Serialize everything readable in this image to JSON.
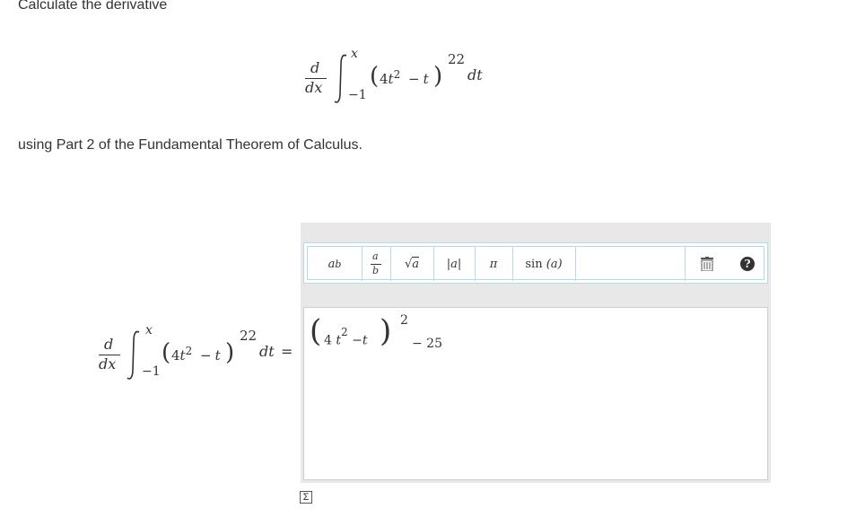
{
  "question": {
    "title": "Calculate the derivative",
    "instructions": "using Part 2 of the Fundamental Theorem of Calculus."
  },
  "expression": {
    "d": "d",
    "dx": "dx",
    "upper_limit": "x",
    "lower_limit": "−1",
    "integrand_4": "4",
    "integrand_t2": "t",
    "integrand_t2_power": "2",
    "integrand_minus": "−",
    "integrand_t": "t",
    "outer_power": "22",
    "dt": "dt",
    "equals": "="
  },
  "toolbar": {
    "power_label": "a",
    "power_sup": "b",
    "fraction_num": "a",
    "fraction_den": "b",
    "sqrt_label": "a",
    "abs_label": "|a|",
    "pi_label": "π",
    "sin_label": "sin",
    "sin_arg": "(a)",
    "icons": [
      "trash-icon",
      "help-icon"
    ]
  },
  "answer": {
    "coef": "4",
    "var": "t",
    "var_power": "2",
    "minus": "−",
    "var2": "t",
    "outer_power": "2",
    "tail": "− 25"
  },
  "colors": {
    "accent_border": "#b5dbe8",
    "panel_bg": "#e8e8e8",
    "text": "#333333"
  }
}
